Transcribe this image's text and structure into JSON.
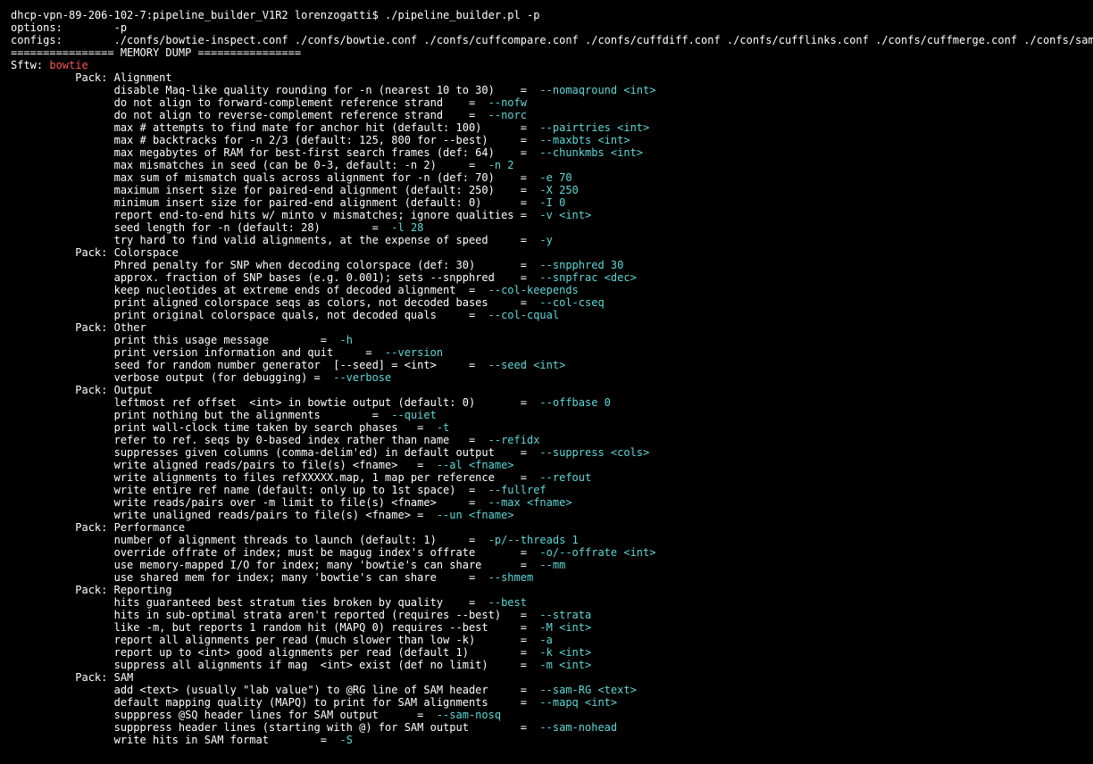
{
  "prompt": {
    "text": "dhcp-vpn-89-206-102-7:pipeline_builder_V1R2 lorenzogatti$ ",
    "cmd": "./pipeline_builder.pl -p"
  },
  "options_label": "options:",
  "options_value": "-p",
  "configs_label": "configs:",
  "configs_value": "./confs/bowtie-inspect.conf ./confs/bowtie.conf ./confs/cuffcompare.conf ./confs/cuffdiff.conf ./confs/cufflinks.conf ./confs/cuffmerge.conf ./confs/samtools.conf ./confs/tophat.conf",
  "mem_dump": "================ MEMORY DUMP ================",
  "sftw_label": "Sftw: ",
  "sftw_value": "bowtie",
  "packs": [
    {
      "title": "Pack: Alignment",
      "rows": [
        {
          "desc": "disable Maq-like quality rounding for -n (nearest 10 to 30)    =  ",
          "opt": "--nomaqround <int>"
        },
        {
          "desc": "do not align to forward-complement reference strand    =  ",
          "opt": "--nofw"
        },
        {
          "desc": "do not align to reverse-complement reference strand    =  ",
          "opt": "--norc"
        },
        {
          "desc": "max # attempts to find mate for anchor hit (default: 100)      =  ",
          "opt": "--pairtries <int>"
        },
        {
          "desc": "max # backtracks for -n 2/3 (default: 125, 800 for --best)     =  ",
          "opt": "--maxbts <int>"
        },
        {
          "desc": "max megabytes of RAM for best-first search frames (def: 64)    =  ",
          "opt": "--chunkmbs <int>"
        },
        {
          "desc": "max mismatches in seed (can be 0-3, default: -n 2)     =  ",
          "opt": "-n 2"
        },
        {
          "desc": "max sum of mismatch quals across alignment for -n (def: 70)    =  ",
          "opt": "-e 70"
        },
        {
          "desc": "maximum insert size for paired-end alignment (default: 250)    =  ",
          "opt": "-X 250"
        },
        {
          "desc": "minimum insert size for paired-end alignment (default: 0)      =  ",
          "opt": "-I 0"
        },
        {
          "desc": "report end-to-end hits w/ minto v mismatches; ignore qualities =  ",
          "opt": "-v <int>"
        },
        {
          "desc": "seed length for -n (default: 28)        =  ",
          "opt": "-l 28"
        },
        {
          "desc": "try hard to find valid alignments, at the expense of speed     =  ",
          "opt": "-y"
        }
      ]
    },
    {
      "title": "Pack: Colorspace",
      "rows": [
        {
          "desc": "Phred penalty for SNP when decoding colorspace (def: 30)       =  ",
          "opt": "--snpphred 30"
        },
        {
          "desc": "approx. fraction of SNP bases (e.g. 0.001); sets --snpphred    =  ",
          "opt": "--snpfrac <dec>"
        },
        {
          "desc": "keep nucleotides at extreme ends of decoded alignment  =  ",
          "opt": "--col-keepends"
        },
        {
          "desc": "print aligned colorspace seqs as colors, not decoded bases     =  ",
          "opt": "--col-cseq"
        },
        {
          "desc": "print original colorspace quals, not decoded quals     =  ",
          "opt": "--col-cqual"
        }
      ]
    },
    {
      "title": "Pack: Other",
      "rows": [
        {
          "desc": "print this usage message        =  ",
          "opt": "-h"
        },
        {
          "desc": "print version information and quit     =  ",
          "opt": "--version"
        },
        {
          "desc": "seed for random number generator  [--seed] = <int>     =  ",
          "opt": "--seed <int>"
        },
        {
          "desc": "verbose output (for debugging) =  ",
          "opt": "--verbose"
        }
      ]
    },
    {
      "title": "Pack: Output",
      "rows": [
        {
          "desc": "leftmost ref offset  <int> in bowtie output (default: 0)       =  ",
          "opt": "--offbase 0"
        },
        {
          "desc": "print nothing but the alignments        =  ",
          "opt": "--quiet"
        },
        {
          "desc": "print wall-clock time taken by search phases   =  ",
          "opt": "-t"
        },
        {
          "desc": "refer to ref. seqs by 0-based index rather than name   =  ",
          "opt": "--refidx"
        },
        {
          "desc": "suppresses given columns (comma-delim'ed) in default output    =  ",
          "opt": "--suppress <cols>"
        },
        {
          "desc": "write aligned reads/pairs to file(s) <fname>   =  ",
          "opt": "--al <fname>"
        },
        {
          "desc": "write alignments to files refXXXXX.map, 1 map per reference    =  ",
          "opt": "--refout"
        },
        {
          "desc": "write entire ref name (default: only up to 1st space)  =  ",
          "opt": "--fullref"
        },
        {
          "desc": "write reads/pairs over -m limit to file(s) <fname>     =  ",
          "opt": "--max <fname>"
        },
        {
          "desc": "write unaligned reads/pairs to file(s) <fname> =  ",
          "opt": "--un <fname>"
        }
      ]
    },
    {
      "title": "Pack: Performance",
      "rows": [
        {
          "desc": "number of alignment threads to launch (default: 1)     =  ",
          "opt": "-p/--threads 1"
        },
        {
          "desc": "override offrate of index; must be magug index's offrate       =  ",
          "opt": "-o/--offrate <int>"
        },
        {
          "desc": "use memory-mapped I/O for index; many 'bowtie's can share      =  ",
          "opt": "--mm"
        },
        {
          "desc": "use shared mem for index; many 'bowtie's can share     =  ",
          "opt": "--shmem"
        }
      ]
    },
    {
      "title": "Pack: Reporting",
      "rows": [
        {
          "desc": "hits guaranteed best stratum ties broken by quality    =  ",
          "opt": "--best"
        },
        {
          "desc": "hits in sub-optimal strata aren't reported (requires --best)   =  ",
          "opt": "--strata"
        },
        {
          "desc": "like -m, but reports 1 random hit (MAPQ 0) requires --best     =  ",
          "opt": "-M <int>"
        },
        {
          "desc": "report all alignments per read (much slower than low -k)       =  ",
          "opt": "-a"
        },
        {
          "desc": "report up to <int> good alignments per read (default 1)        =  ",
          "opt": "-k <int>"
        },
        {
          "desc": "suppress all alignments if mag  <int> exist (def no limit)     =  ",
          "opt": "-m <int>"
        }
      ]
    },
    {
      "title": "Pack: SAM",
      "rows": [
        {
          "desc": "add <text> (usually \"lab value\") to @RG line of SAM header     =  ",
          "opt": "--sam-RG <text>"
        },
        {
          "desc": "default mapping quality (MAPQ) to print for SAM alignments     =  ",
          "opt": "--mapq <int>"
        },
        {
          "desc": "supppress @SQ header lines for SAM output      =  ",
          "opt": "--sam-nosq"
        },
        {
          "desc": "supppress header lines (starting with @) for SAM output        =  ",
          "opt": "--sam-nohead"
        },
        {
          "desc": "write hits in SAM format        =  ",
          "opt": "-S"
        }
      ]
    }
  ]
}
